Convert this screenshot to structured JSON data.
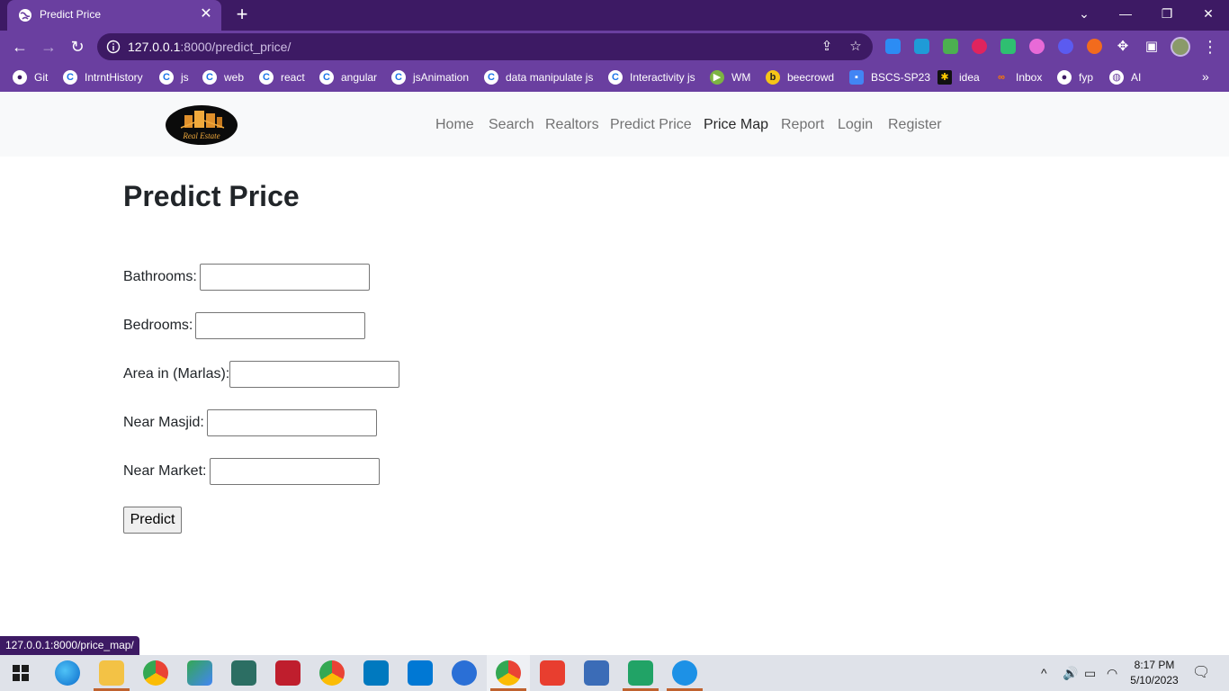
{
  "browser": {
    "tab_title": "Predict Price",
    "url_host": "127.0.0.1",
    "url_rest": ":8000/predict_price/",
    "bookmarks": [
      {
        "label": "Git",
        "icon": "github-icon"
      },
      {
        "label": "IntrntHistory",
        "icon": "chrome-c-icon"
      },
      {
        "label": "js",
        "icon": "chrome-c-icon"
      },
      {
        "label": "web",
        "icon": "chrome-c-icon"
      },
      {
        "label": "react",
        "icon": "chrome-c-icon"
      },
      {
        "label": "angular",
        "icon": "chrome-c-icon"
      },
      {
        "label": "jsAnimation",
        "icon": "chrome-c-icon"
      },
      {
        "label": "data manipulate js",
        "icon": "chrome-c-icon"
      },
      {
        "label": "Interactivity js",
        "icon": "chrome-c-icon"
      },
      {
        "label": "WM",
        "icon": "play-icon"
      },
      {
        "label": "beecrowd",
        "icon": "beecrowd-icon"
      },
      {
        "label": "BSCS-SP23",
        "icon": "contact-card-icon"
      },
      {
        "label": "idea",
        "icon": "idea-icon"
      },
      {
        "label": "Inbox",
        "icon": "link-icon"
      },
      {
        "label": "fyp",
        "icon": "github-icon"
      },
      {
        "label": "AI",
        "icon": "globe-icon"
      }
    ],
    "status_url": "127.0.0.1:8000/price_map/"
  },
  "site": {
    "logo_text": "Real Estate",
    "nav": [
      "Home",
      "Search",
      "Realtors",
      "Predict Price",
      "Price Map",
      "Report",
      "Login",
      "Register"
    ],
    "active_nav": "Price Map"
  },
  "form": {
    "title": "Predict Price",
    "fields": [
      {
        "label": "Bathrooms:",
        "value": ""
      },
      {
        "label": "Bedrooms:",
        "value": ""
      },
      {
        "label": "Area in (Marlas):",
        "value": ""
      },
      {
        "label": "Near Masjid:",
        "value": ""
      },
      {
        "label": "Near Market:",
        "value": ""
      }
    ],
    "submit_label": "Predict"
  },
  "taskbar": {
    "time": "8:17 PM",
    "date": "5/10/2023"
  },
  "colors": {
    "chrome_dark": "#3d1a64",
    "chrome_light": "#6a3fa0",
    "navbar_bg": "#f8f9fa",
    "text": "#212529"
  }
}
